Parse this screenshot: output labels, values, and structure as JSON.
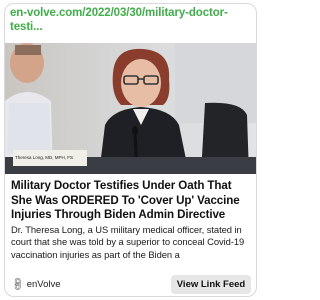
{
  "card": {
    "url": "en-volve.com/2022/03/30/military-doctor-testi...",
    "headline": "Military Doctor Testifies Under Oath That She Was ORDERED To 'Cover Up' Vaccine Injuries Through Biden Admin Directive",
    "description": "Dr. Theresa Long, a US military medical officer, stated in court that she was told by a superior to conceal Covid-19 vaccination injuries as part of the Biden a",
    "source": "enVolve",
    "button_label": "View Link Feed",
    "nameplate": "Theresa Long, MD, MPH, FS"
  },
  "colors": {
    "url": "#3fae49",
    "button_bg": "#e6e6e6"
  },
  "icons": {
    "source_icon": "link-icon"
  }
}
